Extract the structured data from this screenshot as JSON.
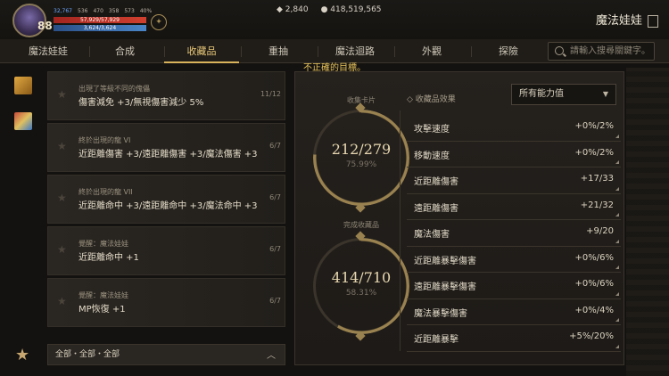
{
  "player": {
    "level": "88",
    "stats": {
      "blue_stat": "32,767",
      "stat2": "536",
      "stat3": "470",
      "stat4": "358",
      "stat5": "573",
      "stat6": "40%"
    },
    "hp_text": "57,929/57,929",
    "mp_text": "3,624/3,624"
  },
  "currency": {
    "diamonds": "2,840",
    "gold": "418,519,565"
  },
  "window_title": "魔法娃娃",
  "tabs": [
    {
      "label": "魔法娃娃",
      "active": false
    },
    {
      "label": "合成",
      "active": false
    },
    {
      "label": "收藏品",
      "active": true
    },
    {
      "label": "重抽",
      "active": false
    },
    {
      "label": "魔法迴路",
      "active": false
    },
    {
      "label": "外觀",
      "active": false
    },
    {
      "label": "探險",
      "active": false
    }
  ],
  "search": {
    "placeholder": "請輸入搜尋關鍵字。"
  },
  "warning": "不正確的目標。",
  "collection_items": [
    {
      "sub": "出現了等級不同的傀儡",
      "main": "傷害減免 +3/無視傷害減少 5%",
      "count": "11/12"
    },
    {
      "sub": "終於出現的龍 VI",
      "main": "近距離傷害 +3/遠距離傷害 +3/魔法傷害 +3",
      "count": "6/7"
    },
    {
      "sub": "終於出現的龍 VII",
      "main": "近距離命中 +3/遠距離命中 +3/魔法命中 +3",
      "count": "6/7"
    },
    {
      "sub": "覺醒：魔法娃娃",
      "main": "近距離命中 +1",
      "count": "6/7"
    },
    {
      "sub": "覺醒：魔法娃娃",
      "main": "MP恢復 +1",
      "count": "6/7"
    }
  ],
  "filter": {
    "label": "全部・全部・全部"
  },
  "cards": {
    "label": "收集卡片",
    "value": "212/279",
    "percent": "75.99%"
  },
  "completed": {
    "label": "完成收藏品",
    "value": "414/710",
    "percent": "58.31%"
  },
  "effects": {
    "title": "收藏品效果",
    "dropdown": "所有能力值",
    "rows": [
      {
        "name": "攻擊速度",
        "value": "+0%/2%"
      },
      {
        "name": "移動速度",
        "value": "+0%/2%"
      },
      {
        "name": "近距離傷害",
        "value": "+17/33"
      },
      {
        "name": "遠距離傷害",
        "value": "+21/32"
      },
      {
        "name": "魔法傷害",
        "value": "+9/20"
      },
      {
        "name": "近距離暴擊傷害",
        "value": "+0%/6%"
      },
      {
        "name": "遠距離暴擊傷害",
        "value": "+0%/6%"
      },
      {
        "name": "魔法暴擊傷害",
        "value": "+0%/4%"
      },
      {
        "name": "近距離暴擊",
        "value": "+5%/20%"
      }
    ]
  },
  "colors": {
    "accent": "#d8b35c",
    "warning": "#e8c45c",
    "hp": "#c0392b",
    "mp": "#3a6fb0"
  }
}
